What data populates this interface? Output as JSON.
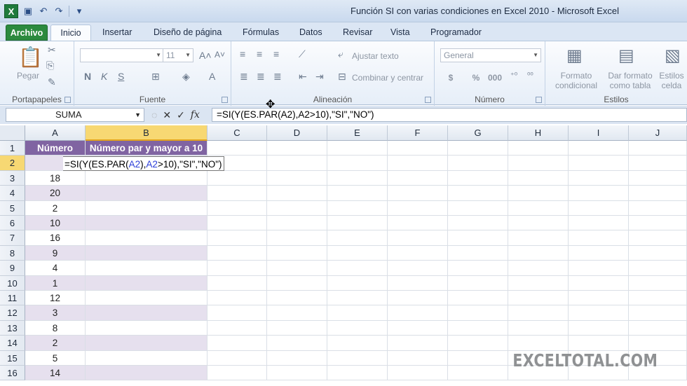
{
  "window": {
    "title": "Función SI con varias condiciones en Excel 2010  -  Microsoft Excel"
  },
  "ribbon_tabs": [
    {
      "label": "Archivo",
      "active": false
    },
    {
      "label": "Inicio",
      "active": true
    },
    {
      "label": "Insertar",
      "active": false
    },
    {
      "label": "Diseño de página",
      "active": false
    },
    {
      "label": "Fórmulas",
      "active": false
    },
    {
      "label": "Datos",
      "active": false
    },
    {
      "label": "Revisar",
      "active": false
    },
    {
      "label": "Vista",
      "active": false
    },
    {
      "label": "Programador",
      "active": false
    }
  ],
  "ribbon": {
    "portapapeles": {
      "label": "Portapapeles",
      "paste": "Pegar"
    },
    "fuente": {
      "label": "Fuente",
      "font_size": "11"
    },
    "alineacion": {
      "label": "Alineación",
      "wrap": "Ajustar texto",
      "merge": "Combinar y centrar"
    },
    "numero": {
      "label": "Número",
      "format": "General",
      "currency": "$",
      "percent": "%",
      "thousands": "000"
    },
    "estilos": {
      "label": "Estilos",
      "cond_format_1": "Formato",
      "cond_format_2": "condicional",
      "table_format_1": "Dar formato",
      "table_format_2": "como tabla",
      "cell_styles_1": "Estilos",
      "cell_styles_2": "celda"
    }
  },
  "formula_bar": {
    "name_box": "SUMA",
    "cancel": "✕",
    "enter": "✓",
    "fx": "fx",
    "formula": "=SI(Y(ES.PAR(A2),A2>10),\"SI\",\"NO\")"
  },
  "columns": [
    "A",
    "B",
    "C",
    "D",
    "E",
    "F",
    "G",
    "H",
    "I",
    "J"
  ],
  "headers": {
    "a1": "Número",
    "b1": "Número par y mayor a 10"
  },
  "edit_cell": {
    "part1": "=SI(Y(ES.PAR(",
    "ref1": "A2",
    "part2": "),",
    "ref2": "A2",
    "part3": ">10),\"SI\",\"NO\")"
  },
  "rows": [
    {
      "row": "1"
    },
    {
      "row": "2"
    },
    {
      "row": "3",
      "a": "18"
    },
    {
      "row": "4",
      "a": "20"
    },
    {
      "row": "5",
      "a": "2"
    },
    {
      "row": "6",
      "a": "10"
    },
    {
      "row": "7",
      "a": "16"
    },
    {
      "row": "8",
      "a": "9"
    },
    {
      "row": "9",
      "a": "4"
    },
    {
      "row": "10",
      "a": "1"
    },
    {
      "row": "11",
      "a": "12"
    },
    {
      "row": "12",
      "a": "3"
    },
    {
      "row": "13",
      "a": "8"
    },
    {
      "row": "14",
      "a": "2"
    },
    {
      "row": "15",
      "a": "5"
    },
    {
      "row": "16",
      "a": "14"
    }
  ],
  "watermark": "EXCELTOTAL.COM"
}
